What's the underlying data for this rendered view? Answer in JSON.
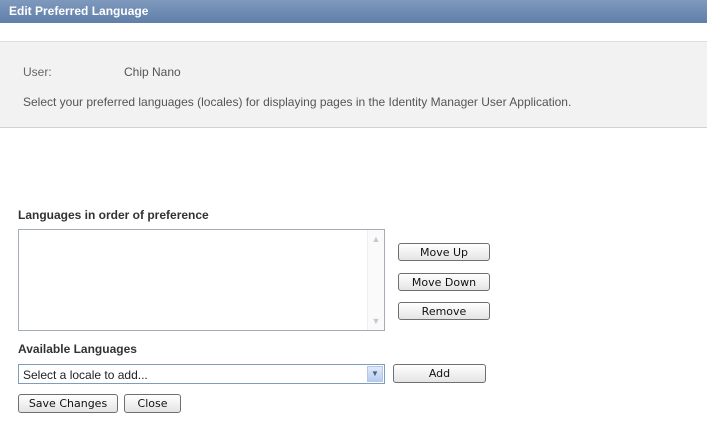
{
  "window": {
    "title": "Edit Preferred Language"
  },
  "info": {
    "user_label": "User:",
    "user_value": "Chip Nano",
    "instruction": "Select your preferred languages (locales) for displaying pages in the Identity Manager User Application."
  },
  "preferences": {
    "label": "Languages in order of preference",
    "items": [],
    "move_up_label": "Move Up",
    "move_down_label": "Move Down",
    "remove_label": "Remove"
  },
  "available": {
    "label": "Available Languages",
    "selected_value": "Select a locale to add...",
    "add_label": "Add"
  },
  "actions": {
    "save_label": "Save Changes",
    "close_label": "Close"
  },
  "colors": {
    "titlebar": "#6b88b2",
    "info_panel": "#f2f2f2"
  }
}
